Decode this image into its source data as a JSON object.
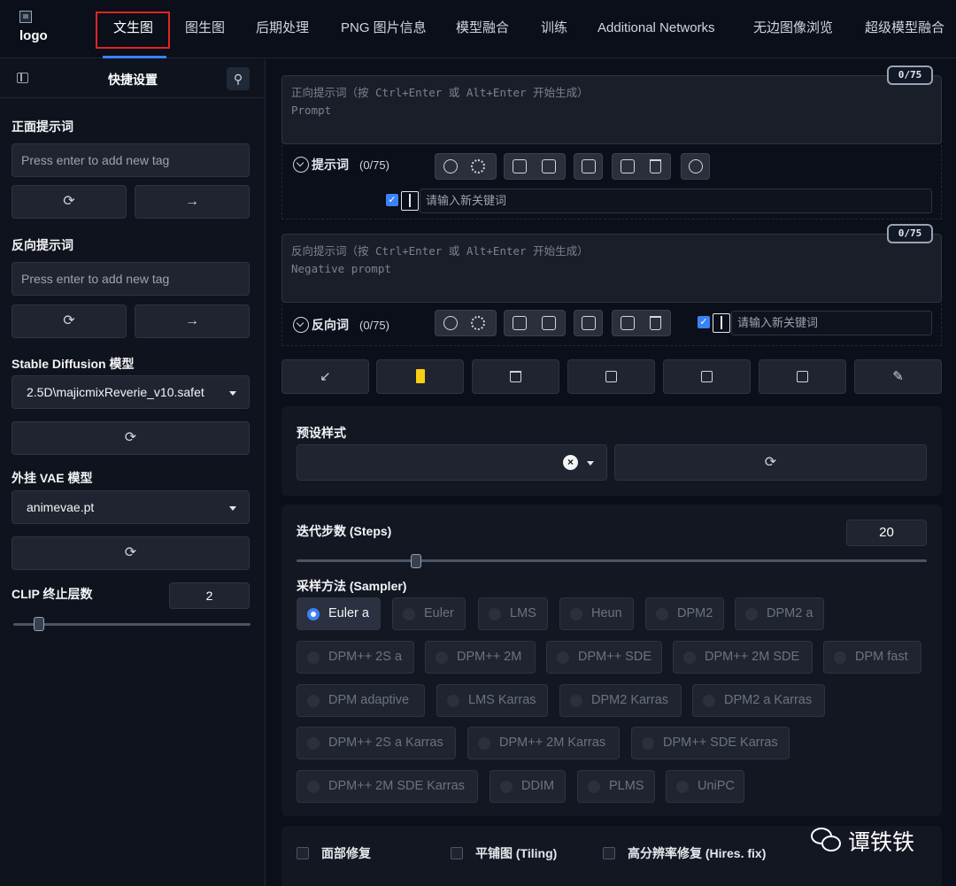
{
  "app": {
    "logo_alt": "logo"
  },
  "tabs": [
    {
      "label": "文生图"
    },
    {
      "label": "图生图"
    },
    {
      "label": "后期处理"
    },
    {
      "label": "PNG 图片信息"
    },
    {
      "label": "模型融合"
    },
    {
      "label": "训练"
    },
    {
      "label": "Additional Networks"
    },
    {
      "label": "无边图像浏览"
    },
    {
      "label": "超级模型融合"
    }
  ],
  "sidebar": {
    "title": "快捷设置",
    "pos_label": "正面提示词",
    "pos_placeholder": "Press enter to add new tag",
    "neg_label": "反向提示词",
    "neg_placeholder": "Press enter to add new tag",
    "refresh_glyph": "⟳",
    "arrow_glyph": "→",
    "pin_glyph": "⚲",
    "sd_label": "Stable Diffusion 模型",
    "sd_value": "2.5D\\majicmixReverie_v10.safet",
    "vae_label": "外挂 VAE 模型",
    "vae_value": "animevae.pt",
    "clip_label": "CLIP 终止层数",
    "clip_value": "2"
  },
  "prompt": {
    "placeholder_line1": "正向提示词（按 Ctrl+Enter 或 Alt+Enter 开始生成）",
    "placeholder_line2": "Prompt",
    "counter": "0/75",
    "collapse_label": "提示词",
    "collapse_count": "(0/75)",
    "keyword_placeholder": "请输入新关键词"
  },
  "negative": {
    "placeholder_line1": "反向提示词（按 Ctrl+Enter 或 Alt+Enter 开始生成）",
    "placeholder_line2": "Negative prompt",
    "counter": "0/75",
    "collapse_label": "反向词",
    "collapse_count": "(0/75)",
    "keyword_placeholder": "请输入新关键词"
  },
  "actions": {
    "read_glyph": "↙",
    "trash_glyph": "🗑",
    "magic_glyph": "✎"
  },
  "styles": {
    "label": "预设样式",
    "clear_glyph": "×",
    "refresh_glyph": "⟳"
  },
  "steps": {
    "label": "迭代步数 (Steps)",
    "value": "20",
    "fraction": 0.19
  },
  "sampler": {
    "label": "采样方法 (Sampler)",
    "selected": "Euler a",
    "options": [
      "Euler a",
      "Euler",
      "LMS",
      "Heun",
      "DPM2",
      "DPM2 a",
      "DPM++ 2S a",
      "DPM++ 2M",
      "DPM++ SDE",
      "DPM++ 2M SDE",
      "DPM fast",
      "DPM adaptive",
      "LMS Karras",
      "DPM2 Karras",
      "DPM2 a Karras",
      "DPM++ 2S a Karras",
      "DPM++ 2M Karras",
      "DPM++ SDE Karras",
      "DPM++ 2M SDE Karras",
      "DDIM",
      "PLMS",
      "UniPC"
    ]
  },
  "options": {
    "face_restore": "面部修复",
    "tiling": "平铺图 (Tiling)",
    "hires_fix": "高分辨率修复 (Hires. fix)"
  },
  "watermark": {
    "text": "谭铁铁"
  },
  "colors": {
    "accent": "#3b82f6",
    "active_tab_outline": "#e02424",
    "style_yellow": "#facc15"
  }
}
